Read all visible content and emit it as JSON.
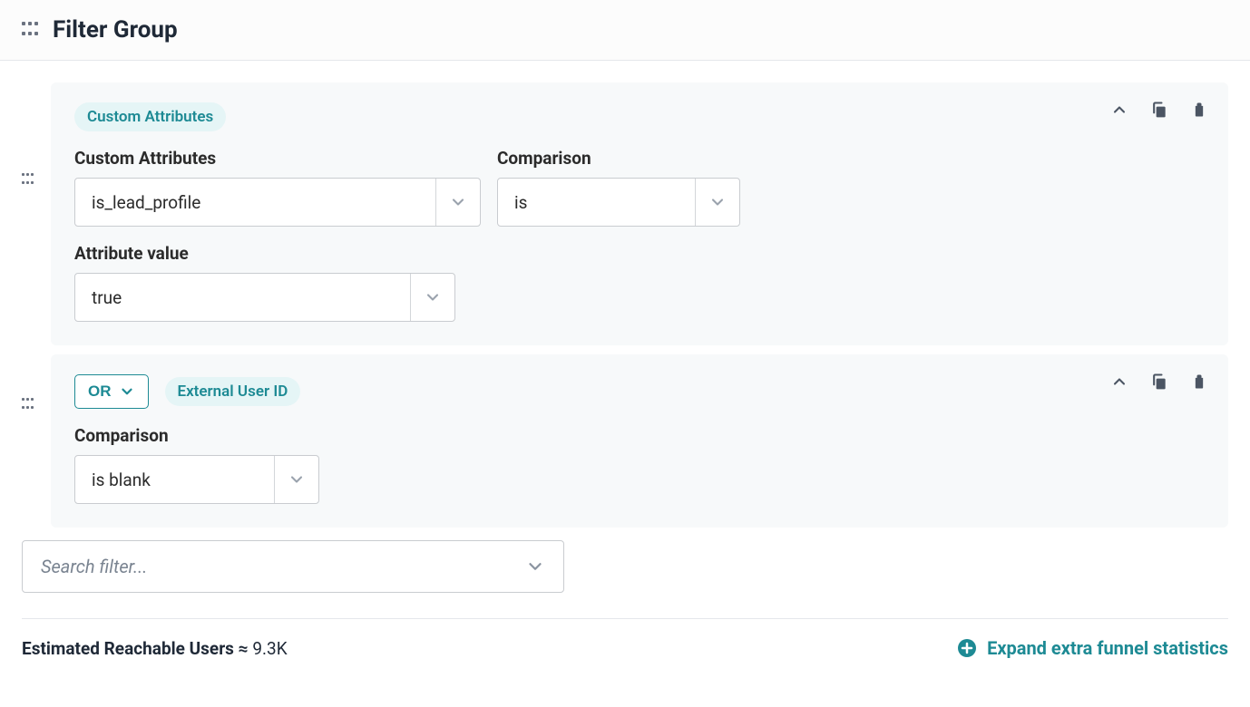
{
  "header": {
    "title": "Filter Group"
  },
  "filters": [
    {
      "chip": "Custom Attributes",
      "attr_label": "Custom Attributes",
      "attr_value": "is_lead_profile",
      "comparison_label": "Comparison",
      "comparison_value": "is",
      "value_label": "Attribute value",
      "value_value": "true"
    },
    {
      "logic": "OR",
      "chip": "External User ID",
      "comparison_label": "Comparison",
      "comparison_value": "is blank"
    }
  ],
  "search": {
    "placeholder": "Search filter..."
  },
  "footer": {
    "estimate_label": "Estimated Reachable Users",
    "estimate_approx": "≈",
    "estimate_value": "9.3K",
    "expand_label": "Expand extra funnel statistics"
  }
}
